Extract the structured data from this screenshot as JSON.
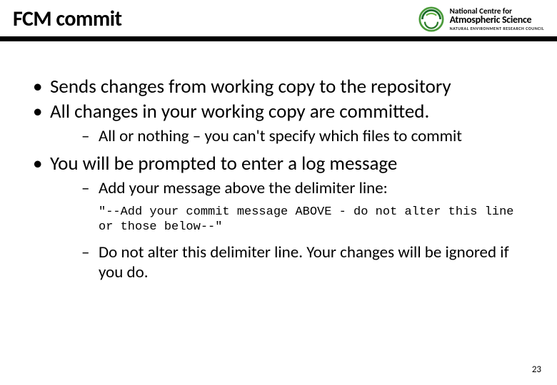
{
  "header": {
    "title": "FCM commit",
    "logo": {
      "line1": "National Centre for",
      "line2": "Atmospheric Science",
      "line3": "NATURAL ENVIRONMENT RESEARCH COUNCIL"
    }
  },
  "bullets": {
    "b1": "Sends changes from working copy to the repository",
    "b2": "All changes in your working copy are committed.",
    "b2_sub1": "All or nothing – you can't specify which files to commit",
    "b3": "You will be prompted to enter a log message",
    "b3_sub1": "Add your message above the delimiter line:",
    "b3_code": "\"--Add your commit message ABOVE - do not alter this line or those below--\"",
    "b3_sub2": "Do not alter this delimiter line. Your changes will be ignored if you do."
  },
  "page_number": "23"
}
